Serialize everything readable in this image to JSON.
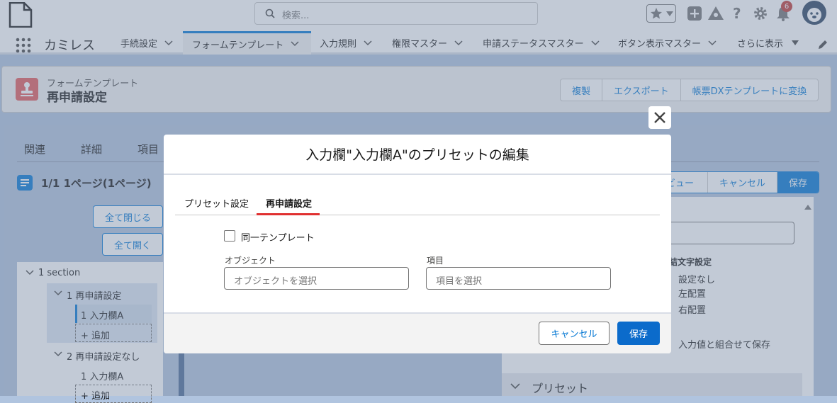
{
  "header": {
    "search_placeholder": "検索...",
    "notification_count": "6"
  },
  "nav": {
    "app_name": "カミレス",
    "items": [
      {
        "label": "手続設定"
      },
      {
        "label": "フォームテンプレート"
      },
      {
        "label": "入力規則"
      },
      {
        "label": "権限マスター"
      },
      {
        "label": "申請ステータスマスター"
      },
      {
        "label": "ボタン表示マスター"
      },
      {
        "label": "さらに表示"
      }
    ]
  },
  "record": {
    "object_type": "フォームテンプレート",
    "name": "再申請設定",
    "actions": [
      "複製",
      "エクスポート",
      "帳票DXテンプレートに変換"
    ]
  },
  "body": {
    "tabs": [
      "関連",
      "詳細",
      "項目"
    ],
    "page_title": "1/1 1ページ(1ページ)",
    "collapse_all": "全て閉じる",
    "expand_all": "全て開く",
    "tree": {
      "section": "1 section",
      "group1": "1 再申請設定",
      "group1_item": "1 入力欄A",
      "add1": "+ 追加",
      "group2": "2 再申請設定なし",
      "group2_item": "1 入力欄A",
      "add2": "+ 追加"
    },
    "right": {
      "preview": "ビュー",
      "cancel": "キャンセル",
      "save": "保存",
      "join_char_label": "結文字設定",
      "opt_none": "設定なし",
      "opt_left": "左配置",
      "opt_right": "右配置",
      "combine_save": "入力値と組合せて保存",
      "preset_section": "プリセット"
    }
  },
  "modal": {
    "title": "入力欄\"入力欄A\"のプリセットの編集",
    "tabs": [
      "プリセット設定",
      "再申請設定"
    ],
    "active_tab": 1,
    "checkbox_label": "同一テンプレート",
    "checkbox_checked": false,
    "object_label": "オブジェクト",
    "object_placeholder": "オブジェクトを選択",
    "field_label": "項目",
    "field_placeholder": "項目を選択",
    "cancel": "キャンセル",
    "save": "保存"
  },
  "colors": {
    "brand": "#0176d3",
    "record_icon": "#e45a5a",
    "active_tab_underline": "#e03030",
    "save_button": "#0b6bcb"
  }
}
